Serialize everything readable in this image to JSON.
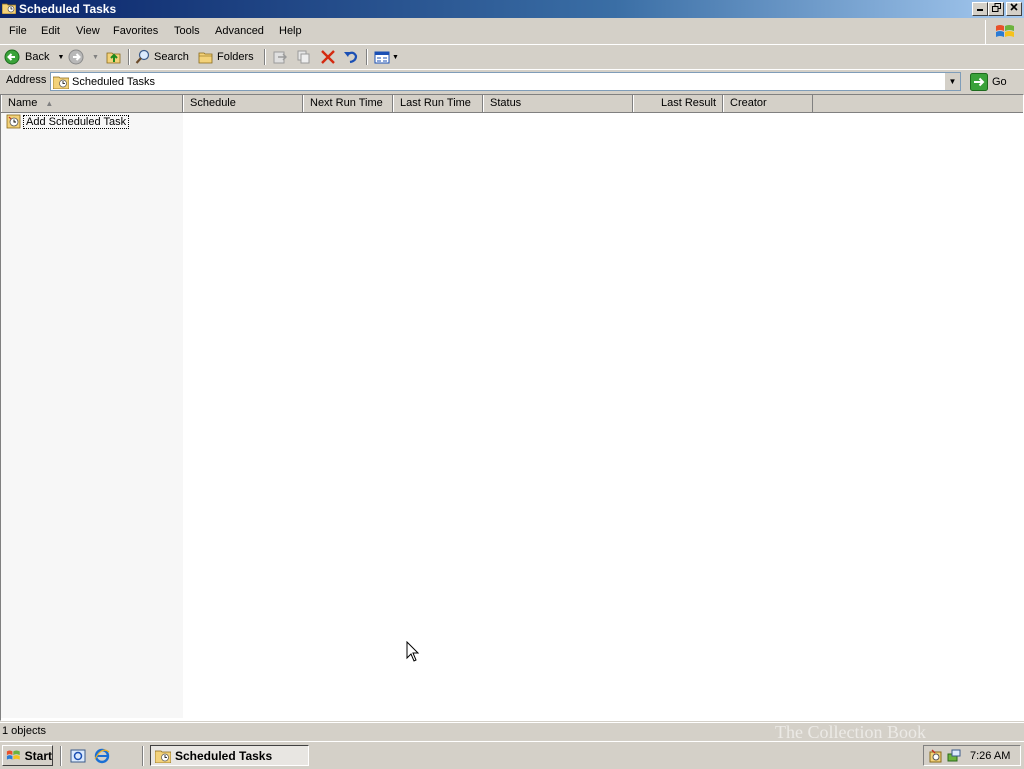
{
  "window": {
    "title": "Scheduled Tasks"
  },
  "menu": [
    "File",
    "Edit",
    "View",
    "Favorites",
    "Tools",
    "Advanced",
    "Help"
  ],
  "toolbar": {
    "back": "Back",
    "search": "Search",
    "folders": "Folders"
  },
  "address": {
    "label": "Address",
    "value": "Scheduled Tasks",
    "go": "Go"
  },
  "list": {
    "columns": [
      "Name",
      "Schedule",
      "Next Run Time",
      "Last Run Time",
      "Status",
      "Last Result",
      "Creator"
    ],
    "items": [
      {
        "name": "Add Scheduled Task"
      }
    ]
  },
  "statusbar": {
    "text": "1 objects"
  },
  "taskbar": {
    "start": "Start",
    "active_task": "Scheduled Tasks",
    "clock": "7:26 AM"
  },
  "watermark": "The Collection Book",
  "colors": {
    "title_start": "#0a246a",
    "title_end": "#a6caf0",
    "face": "#d4d0c8",
    "pane": "#f7f7f7"
  }
}
